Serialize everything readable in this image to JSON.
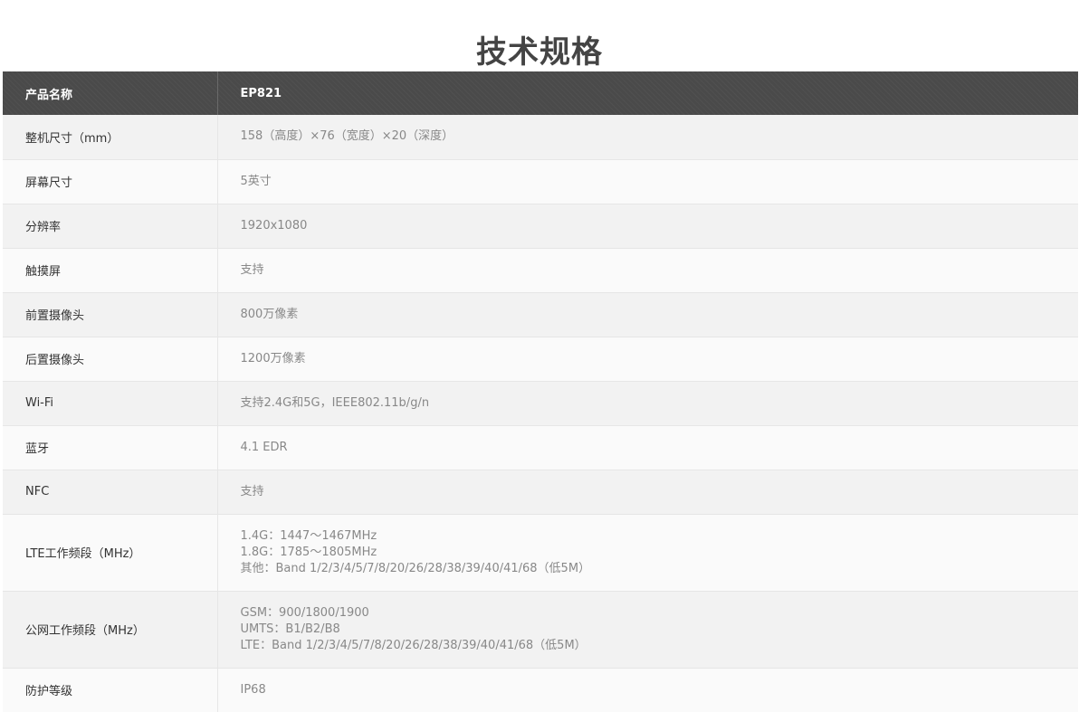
{
  "page": {
    "title": "技术规格"
  },
  "table": {
    "header": {
      "name": "产品名称",
      "value": "EP821"
    },
    "rows": [
      {
        "name": "整机尺寸（mm）",
        "value": "158（高度）×76（宽度）×20（深度）"
      },
      {
        "name": "屏幕尺寸",
        "value": "5英寸"
      },
      {
        "name": "分辨率",
        "value": "1920x1080"
      },
      {
        "name": "触摸屏",
        "value": "支持"
      },
      {
        "name": "前置摄像头",
        "value": "800万像素"
      },
      {
        "name": "后置摄像头",
        "value": "1200万像素"
      },
      {
        "name": "Wi-Fi",
        "value": "支持2.4G和5G，IEEE802.11b/g/n"
      },
      {
        "name": "蓝牙",
        "value": "4.1 EDR"
      },
      {
        "name": "NFC",
        "value": "支持"
      },
      {
        "name": "LTE工作频段（MHz）",
        "lines": [
          "1.4G：1447～1467MHz",
          "1.8G：1785～1805MHz",
          "其他：Band 1/2/3/4/5/7/8/20/26/28/38/39/40/41/68（低5M）"
        ]
      },
      {
        "name": "公网工作频段（MHz）",
        "lines": [
          "GSM：900/1800/1900",
          "UMTS：B1/B2/B8",
          "LTE：Band 1/2/3/4/5/7/8/20/26/28/38/39/40/41/68（低5M）"
        ]
      },
      {
        "name": "防护等级",
        "value": "IP68"
      }
    ]
  },
  "colors": {
    "header_background": "#4a4a4a",
    "row_odd": "#f2f2f2",
    "row_even": "#fafafa",
    "label_text": "#333333",
    "value_text": "#888888"
  }
}
